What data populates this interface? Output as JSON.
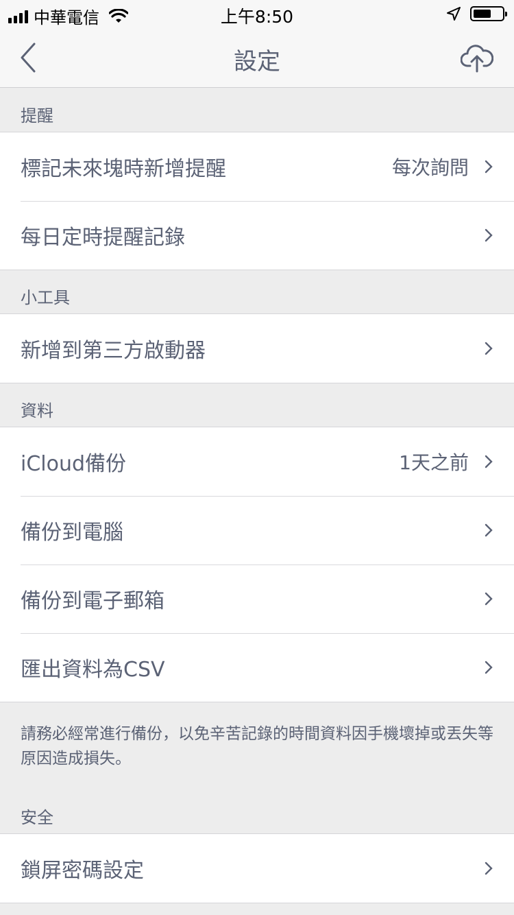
{
  "status": {
    "carrier": "中華電信",
    "time": "上午8:50"
  },
  "nav": {
    "title": "設定"
  },
  "sections": [
    {
      "header": "提醒",
      "rows": [
        {
          "label": "標記未來塊時新增提醒",
          "value": "每次詢問"
        },
        {
          "label": "每日定時提醒記錄",
          "value": ""
        }
      ]
    },
    {
      "header": "小工具",
      "rows": [
        {
          "label": "新增到第三方啟動器",
          "value": ""
        }
      ]
    },
    {
      "header": "資料",
      "rows": [
        {
          "label": "iCloud備份",
          "value": "1天之前"
        },
        {
          "label": "備份到電腦",
          "value": ""
        },
        {
          "label": "備份到電子郵箱",
          "value": ""
        },
        {
          "label": "匯出資料為CSV",
          "value": ""
        }
      ],
      "footer": "請務必經常進行備份，以免辛苦記錄的時間資料因手機壞掉或丟失等原因造成損失。"
    },
    {
      "header": "安全",
      "rows": [
        {
          "label": "鎖屏密碼設定",
          "value": ""
        }
      ]
    }
  ]
}
